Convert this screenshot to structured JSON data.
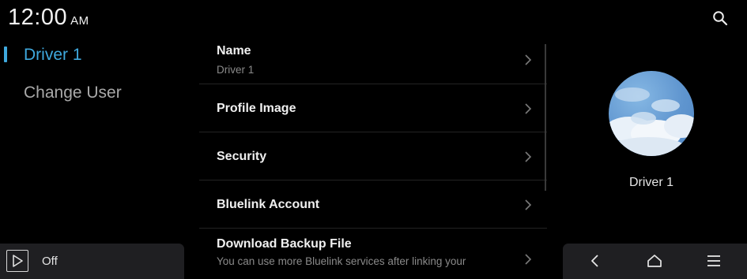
{
  "status": {
    "time": "12:00",
    "ampm": "AM"
  },
  "sidebar": {
    "items": [
      {
        "label": "Driver 1"
      },
      {
        "label": "Change User"
      }
    ]
  },
  "settings": {
    "rows": [
      {
        "title": "Name",
        "subtitle": "Driver 1"
      },
      {
        "title": "Profile Image"
      },
      {
        "title": "Security"
      },
      {
        "title": "Bluelink Account"
      },
      {
        "title": "Download Backup File",
        "subtitle": "You can use more Bluelink services after linking your"
      }
    ]
  },
  "profile": {
    "name": "Driver 1"
  },
  "media": {
    "label": "Off"
  },
  "colors": {
    "accent": "#3fa9de",
    "background": "#000000",
    "bar": "#1f1f22"
  }
}
